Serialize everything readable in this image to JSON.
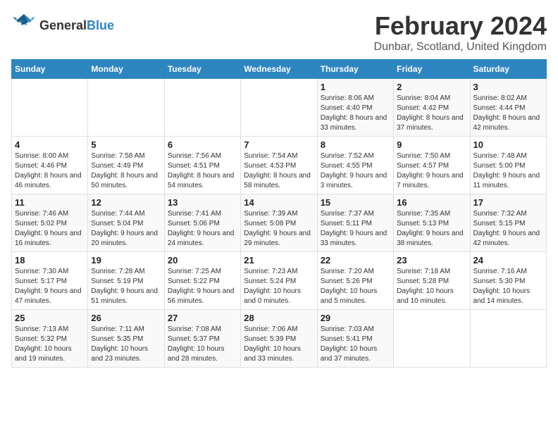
{
  "logo": {
    "general": "General",
    "blue": "Blue"
  },
  "title": "February 2024",
  "subtitle": "Dunbar, Scotland, United Kingdom",
  "days_of_week": [
    "Sunday",
    "Monday",
    "Tuesday",
    "Wednesday",
    "Thursday",
    "Friday",
    "Saturday"
  ],
  "weeks": [
    [
      {
        "day": "",
        "info": ""
      },
      {
        "day": "",
        "info": ""
      },
      {
        "day": "",
        "info": ""
      },
      {
        "day": "",
        "info": ""
      },
      {
        "day": "1",
        "info": "Sunrise: 8:06 AM\nSunset: 4:40 PM\nDaylight: 8 hours and 33 minutes."
      },
      {
        "day": "2",
        "info": "Sunrise: 8:04 AM\nSunset: 4:42 PM\nDaylight: 8 hours and 37 minutes."
      },
      {
        "day": "3",
        "info": "Sunrise: 8:02 AM\nSunset: 4:44 PM\nDaylight: 8 hours and 42 minutes."
      }
    ],
    [
      {
        "day": "4",
        "info": "Sunrise: 8:00 AM\nSunset: 4:46 PM\nDaylight: 8 hours and 46 minutes."
      },
      {
        "day": "5",
        "info": "Sunrise: 7:58 AM\nSunset: 4:49 PM\nDaylight: 8 hours and 50 minutes."
      },
      {
        "day": "6",
        "info": "Sunrise: 7:56 AM\nSunset: 4:51 PM\nDaylight: 8 hours and 54 minutes."
      },
      {
        "day": "7",
        "info": "Sunrise: 7:54 AM\nSunset: 4:53 PM\nDaylight: 8 hours and 58 minutes."
      },
      {
        "day": "8",
        "info": "Sunrise: 7:52 AM\nSunset: 4:55 PM\nDaylight: 9 hours and 3 minutes."
      },
      {
        "day": "9",
        "info": "Sunrise: 7:50 AM\nSunset: 4:57 PM\nDaylight: 9 hours and 7 minutes."
      },
      {
        "day": "10",
        "info": "Sunrise: 7:48 AM\nSunset: 5:00 PM\nDaylight: 9 hours and 11 minutes."
      }
    ],
    [
      {
        "day": "11",
        "info": "Sunrise: 7:46 AM\nSunset: 5:02 PM\nDaylight: 9 hours and 16 minutes."
      },
      {
        "day": "12",
        "info": "Sunrise: 7:44 AM\nSunset: 5:04 PM\nDaylight: 9 hours and 20 minutes."
      },
      {
        "day": "13",
        "info": "Sunrise: 7:41 AM\nSunset: 5:06 PM\nDaylight: 9 hours and 24 minutes."
      },
      {
        "day": "14",
        "info": "Sunrise: 7:39 AM\nSunset: 5:08 PM\nDaylight: 9 hours and 29 minutes."
      },
      {
        "day": "15",
        "info": "Sunrise: 7:37 AM\nSunset: 5:11 PM\nDaylight: 9 hours and 33 minutes."
      },
      {
        "day": "16",
        "info": "Sunrise: 7:35 AM\nSunset: 5:13 PM\nDaylight: 9 hours and 38 minutes."
      },
      {
        "day": "17",
        "info": "Sunrise: 7:32 AM\nSunset: 5:15 PM\nDaylight: 9 hours and 42 minutes."
      }
    ],
    [
      {
        "day": "18",
        "info": "Sunrise: 7:30 AM\nSunset: 5:17 PM\nDaylight: 9 hours and 47 minutes."
      },
      {
        "day": "19",
        "info": "Sunrise: 7:28 AM\nSunset: 5:19 PM\nDaylight: 9 hours and 51 minutes."
      },
      {
        "day": "20",
        "info": "Sunrise: 7:25 AM\nSunset: 5:22 PM\nDaylight: 9 hours and 56 minutes."
      },
      {
        "day": "21",
        "info": "Sunrise: 7:23 AM\nSunset: 5:24 PM\nDaylight: 10 hours and 0 minutes."
      },
      {
        "day": "22",
        "info": "Sunrise: 7:20 AM\nSunset: 5:26 PM\nDaylight: 10 hours and 5 minutes."
      },
      {
        "day": "23",
        "info": "Sunrise: 7:18 AM\nSunset: 5:28 PM\nDaylight: 10 hours and 10 minutes."
      },
      {
        "day": "24",
        "info": "Sunrise: 7:16 AM\nSunset: 5:30 PM\nDaylight: 10 hours and 14 minutes."
      }
    ],
    [
      {
        "day": "25",
        "info": "Sunrise: 7:13 AM\nSunset: 5:32 PM\nDaylight: 10 hours and 19 minutes."
      },
      {
        "day": "26",
        "info": "Sunrise: 7:11 AM\nSunset: 5:35 PM\nDaylight: 10 hours and 23 minutes."
      },
      {
        "day": "27",
        "info": "Sunrise: 7:08 AM\nSunset: 5:37 PM\nDaylight: 10 hours and 28 minutes."
      },
      {
        "day": "28",
        "info": "Sunrise: 7:06 AM\nSunset: 5:39 PM\nDaylight: 10 hours and 33 minutes."
      },
      {
        "day": "29",
        "info": "Sunrise: 7:03 AM\nSunset: 5:41 PM\nDaylight: 10 hours and 37 minutes."
      },
      {
        "day": "",
        "info": ""
      },
      {
        "day": "",
        "info": ""
      }
    ]
  ]
}
